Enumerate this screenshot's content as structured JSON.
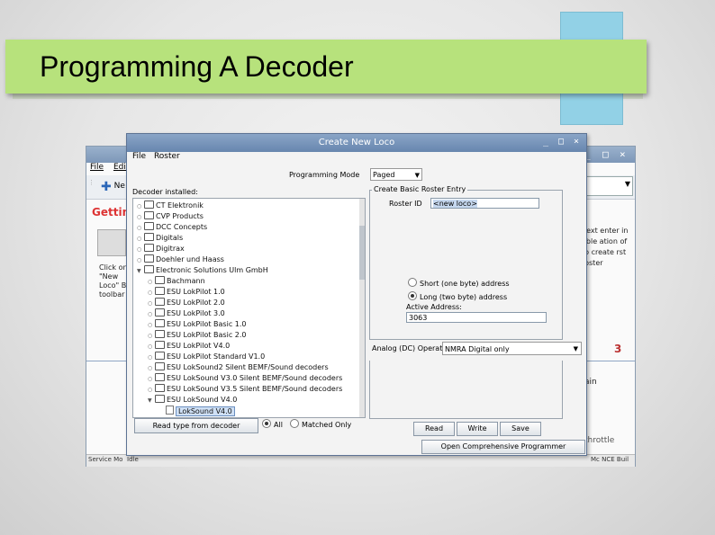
{
  "slide": {
    "title": "Programming A Decoder",
    "colors": {
      "title_band": "#b7e27c",
      "accent_block": "#92d1e6"
    }
  },
  "background_window": {
    "controls": [
      "_",
      "□",
      "×"
    ],
    "menu": [
      "File",
      "Edit"
    ],
    "toolbar_button": "Ne",
    "help_title": "Getting",
    "help_left": "Click on \"New Loco\" Bu toolbar",
    "help_right": "next enter in able ation of to create rst roster",
    "step_number": "3",
    "main_text": "ain",
    "throttle_text": "throttle",
    "status_left": "Service Mo",
    "status_mid": "Idle",
    "status_right": "Mc NCE Buil"
  },
  "dialog": {
    "title": "Create New Loco",
    "controls": [
      "_",
      "□",
      "×"
    ],
    "menu": [
      "File",
      "Roster"
    ],
    "programming_mode_label": "Programming Mode",
    "programming_mode_value": "Paged",
    "decoders_installed_label": "Decoder installed:",
    "tree": [
      {
        "label": "CT Elektronik",
        "level": 0,
        "kind": "folder",
        "expanded": false
      },
      {
        "label": "CVP Products",
        "level": 0,
        "kind": "folder",
        "expanded": false
      },
      {
        "label": "DCC Concepts",
        "level": 0,
        "kind": "folder",
        "expanded": false
      },
      {
        "label": "Digitals",
        "level": 0,
        "kind": "folder",
        "expanded": false
      },
      {
        "label": "Digitrax",
        "level": 0,
        "kind": "folder",
        "expanded": false
      },
      {
        "label": "Doehler und Haass",
        "level": 0,
        "kind": "folder",
        "expanded": false
      },
      {
        "label": "Electronic Solutions Ulm GmbH",
        "level": 0,
        "kind": "folder",
        "expanded": true
      },
      {
        "label": "Bachmann",
        "level": 1,
        "kind": "folder",
        "expanded": false
      },
      {
        "label": "ESU LokPilot 1.0",
        "level": 1,
        "kind": "folder",
        "expanded": false
      },
      {
        "label": "ESU LokPilot 2.0",
        "level": 1,
        "kind": "folder",
        "expanded": false
      },
      {
        "label": "ESU LokPilot 3.0",
        "level": 1,
        "kind": "folder",
        "expanded": false
      },
      {
        "label": "ESU LokPilot Basic 1.0",
        "level": 1,
        "kind": "folder",
        "expanded": false
      },
      {
        "label": "ESU LokPilot Basic 2.0",
        "level": 1,
        "kind": "folder",
        "expanded": false
      },
      {
        "label": "ESU LokPilot V4.0",
        "level": 1,
        "kind": "folder",
        "expanded": false
      },
      {
        "label": "ESU LokPilot Standard V1.0",
        "level": 1,
        "kind": "folder",
        "expanded": false
      },
      {
        "label": "ESU LokSound2 Silent BEMF/Sound decoders",
        "level": 1,
        "kind": "folder",
        "expanded": false
      },
      {
        "label": "ESU LokSound V3.0 Silent BEMF/Sound decoders",
        "level": 1,
        "kind": "folder",
        "expanded": false
      },
      {
        "label": "ESU LokSound V3.5 Silent BEMF/Sound decoders",
        "level": 1,
        "kind": "folder",
        "expanded": false
      },
      {
        "label": "ESU LokSound V4.0",
        "level": 1,
        "kind": "folder",
        "expanded": true
      },
      {
        "label": "LokSound V4.0",
        "level": 2,
        "kind": "leaf",
        "selected": true
      }
    ],
    "read_type_button": "Read type from decoder",
    "filter_all": "All",
    "filter_matched": "Matched Only",
    "roster_group_title": "Create Basic Roster Entry",
    "roster_id_label": "Roster ID",
    "roster_id_value": "<new loco>",
    "short_address": "Short (one byte) address",
    "long_address": "Long (two byte) address",
    "active_address_label": "Active Address:",
    "active_address_value": "3063",
    "analog_label": "Analog (DC) Operation",
    "analog_value": "NMRA Digital only",
    "read_button": "Read",
    "write_button": "Write",
    "save_button": "Save",
    "open_programmer_button": "Open Comprehensive Programmer"
  }
}
